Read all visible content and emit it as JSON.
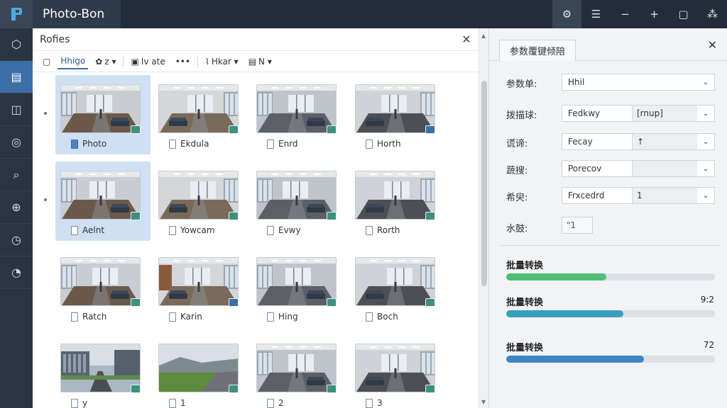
{
  "app": {
    "title": "Photo-Bon"
  },
  "titlebar": {
    "buttons": [
      {
        "name": "settings-gear-icon",
        "glyph": "⚙"
      },
      {
        "name": "menu-list-icon",
        "glyph": "☰"
      },
      {
        "name": "minimize-icon",
        "glyph": "−"
      },
      {
        "name": "add-icon",
        "glyph": "+"
      },
      {
        "name": "document-icon",
        "glyph": "▢"
      },
      {
        "name": "network-icon",
        "glyph": "⁂"
      }
    ]
  },
  "rail": {
    "items": [
      {
        "name": "rail-cube-icon",
        "glyph": "⬡",
        "active": false
      },
      {
        "name": "rail-document-icon",
        "glyph": "▤",
        "active": true
      },
      {
        "name": "rail-book-icon",
        "glyph": "◫",
        "active": false
      },
      {
        "name": "rail-user-icon",
        "glyph": "◎",
        "active": false
      },
      {
        "name": "rail-search-icon",
        "glyph": "⌕",
        "active": false
      },
      {
        "name": "rail-compass-icon",
        "glyph": "⊕",
        "active": false
      },
      {
        "name": "rail-clock-icon",
        "glyph": "◷",
        "active": false
      },
      {
        "name": "rail-speed-icon",
        "glyph": "◔",
        "active": false
      }
    ]
  },
  "main": {
    "header_title": "Rofies",
    "close_label": "✕",
    "toolbar": [
      {
        "name": "toolbar-new-button",
        "icon": "▢",
        "label": "",
        "underline": false
      },
      {
        "name": "toolbar-image-tab",
        "icon": "",
        "label": "Hhigo",
        "underline": true
      },
      {
        "name": "toolbar-filter-button",
        "icon": "✿",
        "label": "z ▾",
        "underline": false
      },
      {
        "name": "toolbar-view-button",
        "icon": "▣",
        "label": "Iv ate",
        "underline": false
      },
      {
        "name": "toolbar-more-button",
        "icon": "",
        "label": "•••",
        "underline": false
      },
      {
        "name": "toolbar-sort-button",
        "icon": "⌇",
        "label": "Hkar ▾",
        "underline": false
      },
      {
        "name": "toolbar-layout-button",
        "icon": "▤",
        "label": "N ▾",
        "underline": false
      }
    ],
    "grid": [
      [
        {
          "label": "Photo",
          "selected": true,
          "scene": 0,
          "badge": "green",
          "icon": "blue"
        },
        {
          "label": "Ekdula",
          "selected": false,
          "scene": 1,
          "badge": "green",
          "icon": "plain"
        },
        {
          "label": "Enrd",
          "selected": false,
          "scene": 2,
          "badge": "green",
          "icon": "plain"
        },
        {
          "label": "Horth",
          "selected": false,
          "scene": 3,
          "badge": "blue",
          "icon": "plain"
        }
      ],
      [
        {
          "label": "Aelnt",
          "selected": true,
          "scene": 4,
          "badge": "green",
          "icon": "plain"
        },
        {
          "label": "Yowcam",
          "selected": false,
          "scene": 5,
          "badge": "green",
          "icon": "plain"
        },
        {
          "label": "Evwy",
          "selected": false,
          "scene": 6,
          "badge": "green",
          "icon": "plain"
        },
        {
          "label": "Rorth",
          "selected": false,
          "scene": 7,
          "badge": "green",
          "icon": "plain"
        }
      ],
      [
        {
          "label": "Ratch",
          "selected": false,
          "scene": 8,
          "badge": "green",
          "icon": "plain"
        },
        {
          "label": "Karin",
          "selected": false,
          "scene": 9,
          "badge": "blue",
          "icon": "plain"
        },
        {
          "label": "Hing",
          "selected": false,
          "scene": 10,
          "badge": "green",
          "icon": "plain"
        },
        {
          "label": "Boch",
          "selected": false,
          "scene": 11,
          "badge": "green",
          "icon": "plain"
        }
      ],
      [
        {
          "label": "y",
          "selected": false,
          "scene": 12,
          "badge": "green",
          "icon": "plain"
        },
        {
          "label": "1",
          "selected": false,
          "scene": 13,
          "badge": "green",
          "icon": "plain"
        },
        {
          "label": "2",
          "selected": false,
          "scene": 14,
          "badge": "green",
          "icon": "plain"
        },
        {
          "label": "3",
          "selected": false,
          "scene": 15,
          "badge": "green",
          "icon": "plain"
        }
      ]
    ]
  },
  "props": {
    "tab_label": "参数覆键倾陪",
    "close_label": "✕",
    "rows": [
      {
        "label": "参数单:",
        "value": "Hhil",
        "value2": "",
        "type": "select"
      },
      {
        "label": "拨描球:",
        "value": "Fedkwy",
        "value2": "[rnup]",
        "type": "split"
      },
      {
        "label": "谎谛:",
        "value": "Fecay",
        "value2": "↑",
        "type": "split"
      },
      {
        "label": "蔬搜:",
        "value": "Porecov",
        "value2": "",
        "type": "split"
      },
      {
        "label": "希臾:",
        "value": "Frxcedrd",
        "value2": "1",
        "type": "split"
      },
      {
        "label": "水鼓:",
        "value": "\"1",
        "value2": "",
        "type": "small"
      }
    ],
    "progress": [
      {
        "label": "批量转换",
        "value": "",
        "fraction": 0.48,
        "color": "#4cbf74"
      },
      {
        "label": "批量转换",
        "value": "9:2",
        "fraction": 0.56,
        "color": "#3a9fbf"
      },
      {
        "label": "批量转换",
        "value": "72",
        "fraction": 0.66,
        "color": "#3d85c8"
      }
    ]
  }
}
